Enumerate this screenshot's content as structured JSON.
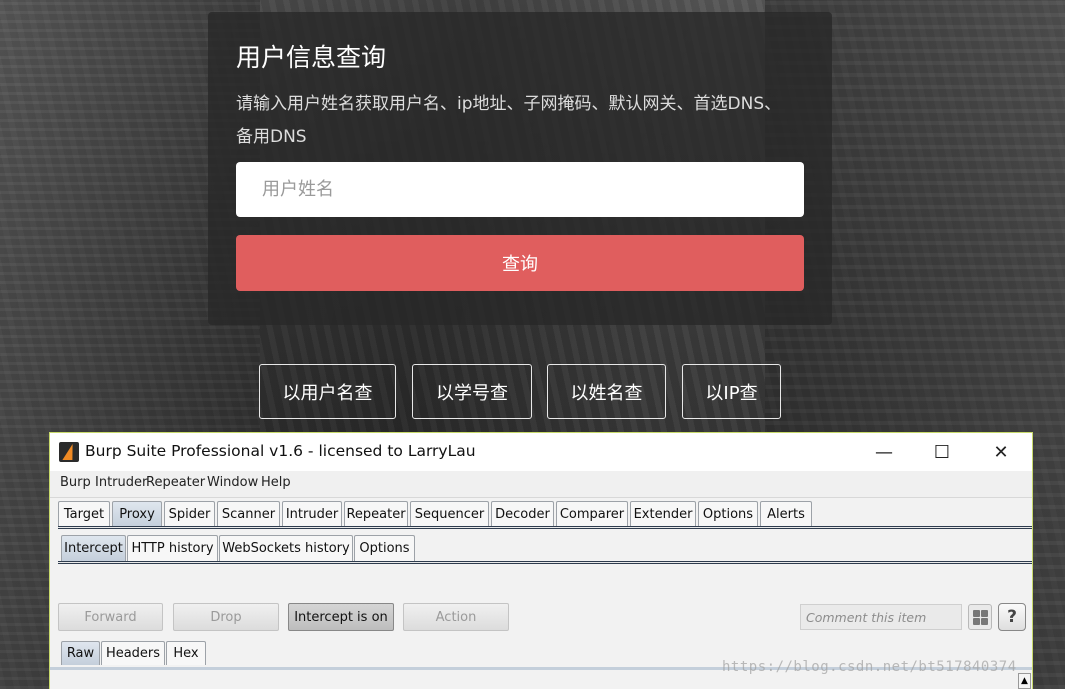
{
  "form": {
    "title": "用户信息查询",
    "description": "请输入用户姓名获取用户名、ip地址、子网掩码、默认网关、首选DNS、备用DNS",
    "input_placeholder": "用户姓名",
    "input_value": "",
    "submit_label": "查询"
  },
  "modes": [
    {
      "label": "以用户名查"
    },
    {
      "label": "以学号查"
    },
    {
      "label": "以姓名查"
    },
    {
      "label": "以IP查"
    }
  ],
  "burp": {
    "title": "Burp Suite Professional v1.6 - licensed to LarryLau",
    "window_controls": {
      "minimize": "—",
      "maximize": "☐",
      "close": "✕"
    },
    "menu": [
      "Burp",
      "Intruder",
      "Repeater",
      "Window",
      "Help"
    ],
    "tabs": [
      "Target",
      "Proxy",
      "Spider",
      "Scanner",
      "Intruder",
      "Repeater",
      "Sequencer",
      "Decoder",
      "Comparer",
      "Extender",
      "Options",
      "Alerts"
    ],
    "active_tab": "Proxy",
    "proxy_tabs": [
      "Intercept",
      "HTTP history",
      "WebSockets history",
      "Options"
    ],
    "active_proxy_tab": "Intercept",
    "buttons": {
      "forward": "Forward",
      "drop": "Drop",
      "intercept": "Intercept is on",
      "action": "Action"
    },
    "comment_placeholder": "Comment this item",
    "help": "?",
    "message_tabs": [
      "Raw",
      "Headers",
      "Hex"
    ],
    "active_message_tab": "Raw",
    "scroll_up": "▲",
    "icons": {
      "logo": "burp-logo-icon",
      "grid": "grid-icon"
    }
  },
  "watermark": "https://blog.csdn.net/bt517840374"
}
